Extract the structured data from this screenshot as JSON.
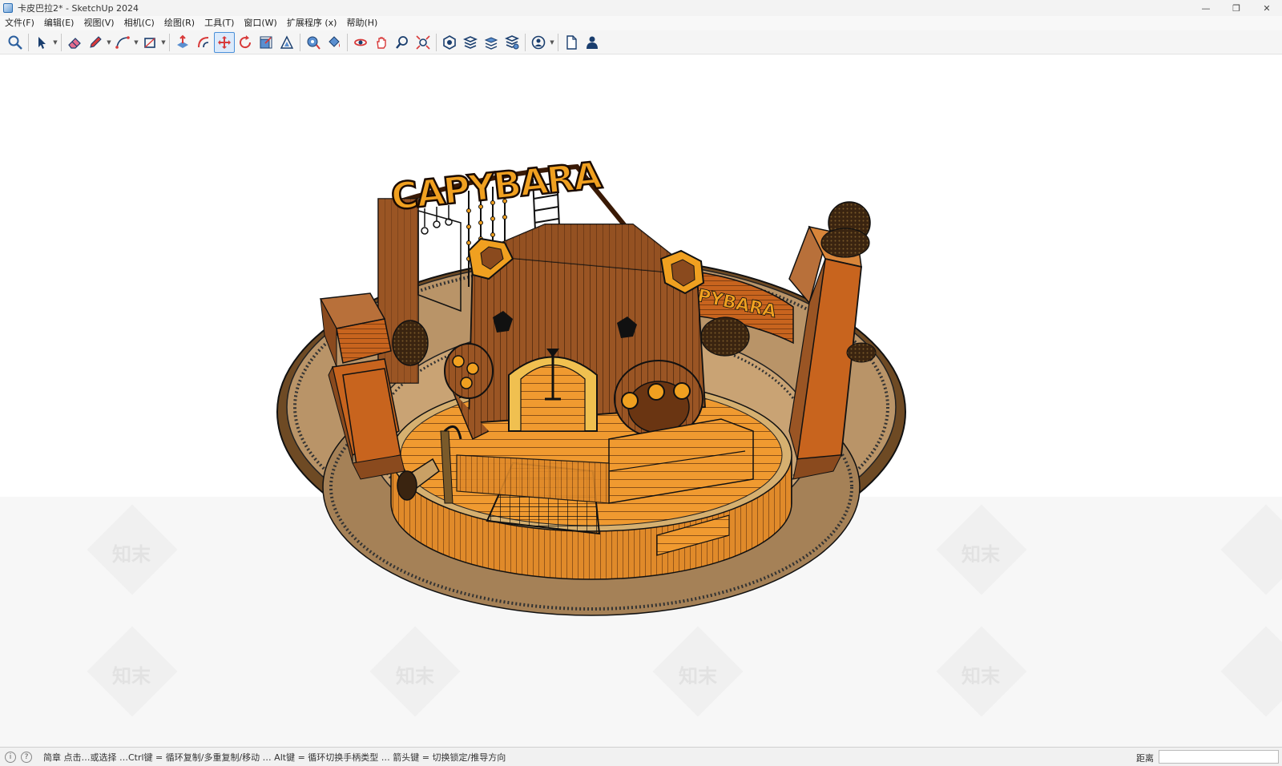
{
  "window": {
    "title": "卡皮巴拉2* - SketchUp 2024",
    "minimize_glyph": "—",
    "restore_glyph": "❐",
    "close_glyph": "✕"
  },
  "menu": {
    "items": [
      {
        "label": "文件(F)"
      },
      {
        "label": "编辑(E)"
      },
      {
        "label": "视图(V)"
      },
      {
        "label": "相机(C)"
      },
      {
        "label": "绘图(R)"
      },
      {
        "label": "工具(T)"
      },
      {
        "label": "窗口(W)"
      },
      {
        "label": "扩展程序 (x)"
      },
      {
        "label": "帮助(H)"
      }
    ]
  },
  "toolbar": {
    "tools": [
      {
        "name": "search-tool",
        "icon": "magnifier-icon"
      },
      {
        "name": "select-tool",
        "icon": "arrow-cursor-icon",
        "dropdown": true
      },
      {
        "name": "eraser-tool",
        "icon": "eraser-icon"
      },
      {
        "name": "pencil-tool",
        "icon": "pencil-icon",
        "dropdown": true
      },
      {
        "name": "arc-tool",
        "icon": "arc-icon",
        "dropdown": true
      },
      {
        "name": "shape-tool",
        "icon": "rectangle-icon",
        "dropdown": true
      },
      {
        "name": "push-pull-tool",
        "icon": "push-pull-icon"
      },
      {
        "name": "follow-me-tool",
        "icon": "follow-me-icon"
      },
      {
        "name": "move-tool",
        "icon": "move-icon",
        "active": true
      },
      {
        "name": "rotate-tool",
        "icon": "rotate-icon"
      },
      {
        "name": "scale-tool",
        "icon": "scale-icon"
      },
      {
        "name": "offset-tool",
        "icon": "offset-icon"
      },
      {
        "name": "tape-measure-tool",
        "icon": "tape-measure-icon"
      },
      {
        "name": "paint-bucket-tool",
        "icon": "paint-bucket-icon"
      },
      {
        "name": "orbit-tool",
        "icon": "orbit-icon"
      },
      {
        "name": "pan-tool",
        "icon": "pan-hand-icon"
      },
      {
        "name": "zoom-tool",
        "icon": "zoom-icon"
      },
      {
        "name": "zoom-extents-tool",
        "icon": "zoom-extents-icon"
      },
      {
        "name": "warehouse-tool",
        "icon": "warehouse-icon"
      },
      {
        "name": "extension-warehouse-tool",
        "icon": "extension-warehouse-icon"
      },
      {
        "name": "layout-tool",
        "icon": "layout-icon"
      },
      {
        "name": "extension-manager-tool",
        "icon": "extension-manager-icon"
      },
      {
        "name": "account-tool",
        "icon": "account-icon",
        "dropdown": true
      },
      {
        "name": "new-file-tool",
        "icon": "new-file-icon"
      },
      {
        "name": "user-tool",
        "icon": "user-icon"
      }
    ]
  },
  "model": {
    "sign_text": "CAPYBARA",
    "wall_text": "PYBARA",
    "colors": {
      "wood_dark": "#5a2e0e",
      "wood_mid": "#9a5524",
      "wood_orange": "#c8641e",
      "wood_light": "#e08a2a",
      "sign_orange": "#f0a020",
      "floor_tan": "#b99468",
      "floor_light": "#d8b88a",
      "edge_black": "#1a1a1a"
    }
  },
  "watermark": {
    "text": "知末"
  },
  "status": {
    "text": "简章 点击…或选择 …Ctrl键 = 循环复制/多重复制/移动 … Alt键 = 循环切换手柄类型 … 箭头键 = 切换锁定/推导方向",
    "measure_label": "距离",
    "measure_value": ""
  }
}
